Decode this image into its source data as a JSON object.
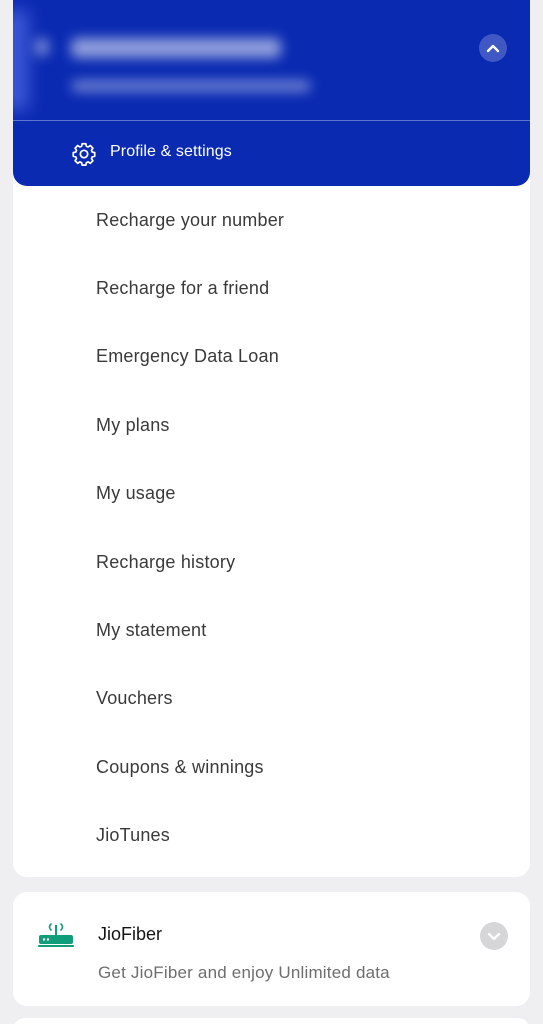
{
  "account": {
    "name": "Mr. Mrinthur Sahu",
    "subtitle": "•••••••••• · Prepaid ••••",
    "profile_settings_label": "Profile & settings"
  },
  "menu": {
    "items": [
      {
        "label": "Recharge your number"
      },
      {
        "label": "Recharge for a friend"
      },
      {
        "label": "Emergency Data Loan"
      },
      {
        "label": "My plans"
      },
      {
        "label": "My usage"
      },
      {
        "label": "Recharge history"
      },
      {
        "label": "My statement"
      },
      {
        "label": "Vouchers"
      },
      {
        "label": "Coupons & winnings"
      },
      {
        "label": "JioTunes"
      }
    ]
  },
  "jiofiber": {
    "title": "JioFiber",
    "subtitle": "Get JioFiber and enjoy Unlimited data",
    "icon": "router-icon"
  },
  "colors": {
    "brand_blue": "#0a2ab2",
    "router_green": "#0f9d7a",
    "text_primary": "#3a3a3a",
    "text_secondary": "#6e6e6e"
  }
}
